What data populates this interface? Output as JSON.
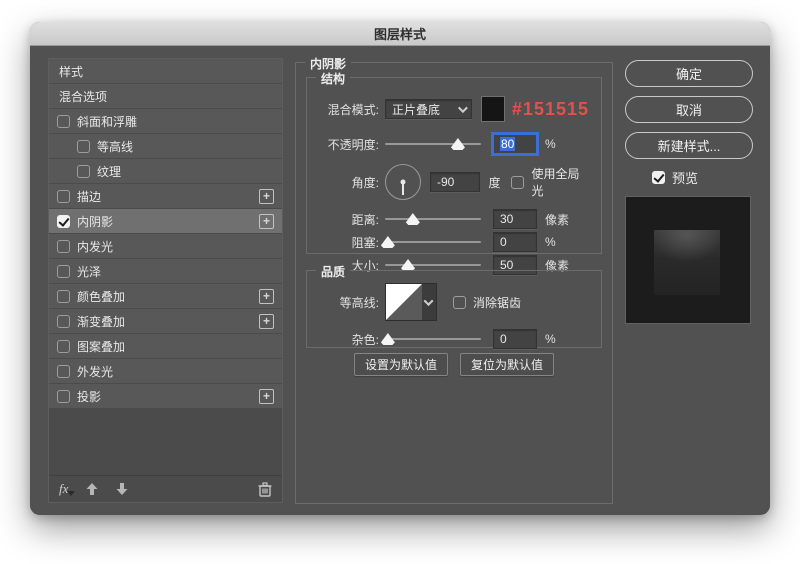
{
  "window": {
    "title": "图层样式"
  },
  "sidebar": {
    "items": [
      {
        "id": "styles",
        "label": "样式",
        "checkbox": false,
        "checked": false,
        "plus": false,
        "indent": false,
        "selected": false
      },
      {
        "id": "blending-options",
        "label": "混合选项",
        "checkbox": false,
        "checked": false,
        "plus": false,
        "indent": false,
        "selected": false
      },
      {
        "id": "bevel-emboss",
        "label": "斜面和浮雕",
        "checkbox": true,
        "checked": false,
        "plus": false,
        "indent": false,
        "selected": false
      },
      {
        "id": "contour",
        "label": "等高线",
        "checkbox": true,
        "checked": false,
        "plus": false,
        "indent": true,
        "selected": false
      },
      {
        "id": "texture",
        "label": "纹理",
        "checkbox": true,
        "checked": false,
        "plus": false,
        "indent": true,
        "selected": false
      },
      {
        "id": "stroke",
        "label": "描边",
        "checkbox": true,
        "checked": false,
        "plus": true,
        "indent": false,
        "selected": false
      },
      {
        "id": "inner-shadow",
        "label": "内阴影",
        "checkbox": true,
        "checked": true,
        "plus": true,
        "indent": false,
        "selected": true
      },
      {
        "id": "inner-glow",
        "label": "内发光",
        "checkbox": true,
        "checked": false,
        "plus": false,
        "indent": false,
        "selected": false
      },
      {
        "id": "satin",
        "label": "光泽",
        "checkbox": true,
        "checked": false,
        "plus": false,
        "indent": false,
        "selected": false
      },
      {
        "id": "color-overlay",
        "label": "颜色叠加",
        "checkbox": true,
        "checked": false,
        "plus": true,
        "indent": false,
        "selected": false
      },
      {
        "id": "gradient-overlay",
        "label": "渐变叠加",
        "checkbox": true,
        "checked": false,
        "plus": true,
        "indent": false,
        "selected": false
      },
      {
        "id": "pattern-overlay",
        "label": "图案叠加",
        "checkbox": true,
        "checked": false,
        "plus": false,
        "indent": false,
        "selected": false
      },
      {
        "id": "outer-glow",
        "label": "外发光",
        "checkbox": true,
        "checked": false,
        "plus": false,
        "indent": false,
        "selected": false
      },
      {
        "id": "drop-shadow",
        "label": "投影",
        "checkbox": true,
        "checked": false,
        "plus": true,
        "indent": false,
        "selected": false
      }
    ],
    "toolbar": {
      "fx_label": "fx"
    }
  },
  "panel": {
    "title": "内阴影",
    "structure": {
      "legend": "结构",
      "blend_mode_label": "混合模式:",
      "blend_mode_value": "正片叠底",
      "color_hex": "#151515",
      "opacity_label": "不透明度:",
      "opacity_value": "80",
      "opacity_unit": "%",
      "angle_label": "角度:",
      "angle_value": "-90",
      "angle_unit": "度",
      "global_light_label": "使用全局光",
      "distance_label": "距离:",
      "distance_value": "30",
      "distance_unit": "像素",
      "choke_label": "阻塞:",
      "choke_value": "0",
      "choke_unit": "%",
      "size_label": "大小:",
      "size_value": "50",
      "size_unit": "像素"
    },
    "quality": {
      "legend": "品质",
      "contour_label": "等高线:",
      "antialias_label": "消除锯齿",
      "noise_label": "杂色:",
      "noise_value": "0",
      "noise_unit": "%"
    },
    "default_buttons": {
      "make_default": "设置为默认值",
      "reset_default": "复位为默认值"
    }
  },
  "actions": {
    "ok": "确定",
    "cancel": "取消",
    "new_style": "新建样式...",
    "preview": "预览"
  },
  "icons": {
    "plus": "+"
  },
  "colors": {
    "swatch": "#151515",
    "accent_red": "#e0524a",
    "selection_blue": "#3a6fd8"
  },
  "sliders": {
    "opacity": 76,
    "distance": 29,
    "choke": 3,
    "size": 24,
    "noise": 3
  }
}
